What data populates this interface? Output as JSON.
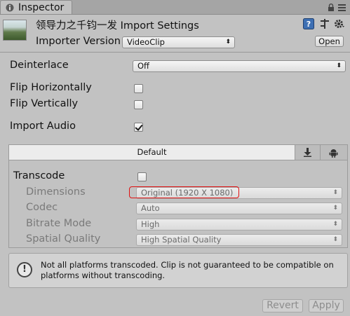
{
  "window": {
    "tab_title": "Inspector",
    "controls": "▲ ≡"
  },
  "header": {
    "title": "领导力之千钧一发 Import Settings",
    "importer_label": "Importer Version",
    "importer_value": "VideoClip",
    "open_label": "Open"
  },
  "settings": {
    "deinterlace_label": "Deinterlace",
    "deinterlace_value": "Off",
    "flip_h_label": "Flip Horizontally",
    "flip_v_label": "Flip Vertically",
    "import_audio_label": "Import Audio",
    "flip_h_checked": false,
    "flip_v_checked": false,
    "import_audio_checked": true
  },
  "platform": {
    "default_tab": "Default",
    "transcode_label": "Transcode",
    "transcode_checked": false,
    "dimensions_label": "Dimensions",
    "dimensions_value": "Original (1920 X 1080)",
    "codec_label": "Codec",
    "codec_value": "Auto",
    "bitrate_label": "Bitrate Mode",
    "bitrate_value": "High",
    "spatial_label": "Spatial Quality",
    "spatial_value": "High Spatial Quality"
  },
  "help": {
    "icon": "!",
    "text": "Not all platforms transcoded. Clip is not guaranteed to be compatible on platforms without transcoding."
  },
  "footer": {
    "revert_label": "Revert",
    "apply_label": "Apply"
  },
  "colors": {
    "background": "#c2c2c2",
    "highlight": "#e01010",
    "help_bg": "#d2d2d2"
  }
}
